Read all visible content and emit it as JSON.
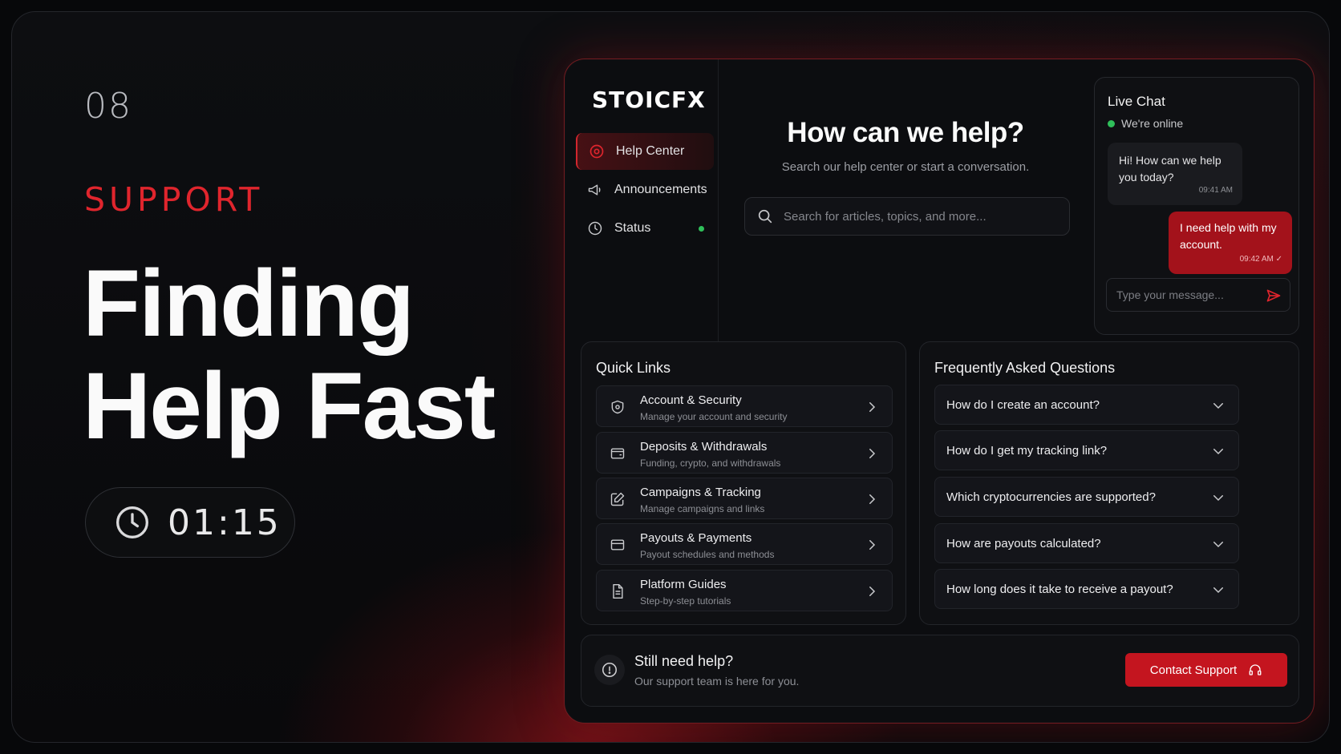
{
  "hero": {
    "slide_number": "08",
    "section": "SUPPORT",
    "title_line1": "Finding",
    "title_line2": "Help Fast",
    "timer": "01:15"
  },
  "app": {
    "logo": "STOICFX",
    "nav": [
      {
        "label": "Help Center",
        "icon": "help-center-icon",
        "active": true
      },
      {
        "label": "Announcements",
        "icon": "megaphone-icon",
        "active": false
      },
      {
        "label": "Status",
        "icon": "clock-icon",
        "active": false,
        "status_color": "#2fbf5a"
      }
    ],
    "help": {
      "title": "How can we help?",
      "subtitle": "Search our help center or start a conversation.",
      "search_placeholder": "Search for articles, topics, and more..."
    },
    "chat": {
      "title": "Live Chat",
      "status": "We're online",
      "messages": [
        {
          "from": "agent",
          "text": "Hi! How can we help you today?",
          "time": "09:41 AM"
        },
        {
          "from": "user",
          "text": "I need help with my account.",
          "time": "09:42 AM ✓"
        }
      ],
      "input_placeholder": "Type your message..."
    },
    "quick_links": {
      "title": "Quick Links",
      "items": [
        {
          "title": "Account & Security",
          "subtitle": "Manage your account and security",
          "icon": "shield-icon"
        },
        {
          "title": "Deposits & Withdrawals",
          "subtitle": "Funding, crypto, and withdrawals",
          "icon": "wallet-icon"
        },
        {
          "title": "Campaigns & Tracking",
          "subtitle": "Manage campaigns and links",
          "icon": "edit-icon"
        },
        {
          "title": "Payouts & Payments",
          "subtitle": "Payout schedules and methods",
          "icon": "card-icon"
        },
        {
          "title": "Platform Guides",
          "subtitle": "Step-by-step tutorials",
          "icon": "document-icon"
        }
      ]
    },
    "faq": {
      "title": "Frequently Asked Questions",
      "items": [
        "How do I create an account?",
        "How do I get my tracking link?",
        "Which cryptocurrencies are supported?",
        "How are payouts calculated?",
        "How long does it take to receive a payout?"
      ]
    },
    "bottom": {
      "title": "Still need help?",
      "subtitle": "Our support team is here for you.",
      "button": "Contact Support"
    }
  },
  "colors": {
    "accent": "#c4151f",
    "online": "#2fbf5a",
    "background": "#0c0d10"
  }
}
